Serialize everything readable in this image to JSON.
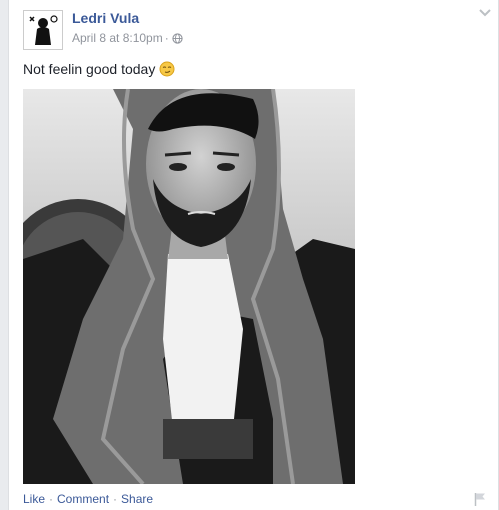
{
  "post": {
    "author": "Ledri Vula",
    "timestamp": "April 8 at 8:10pm",
    "separator": "·",
    "privacy_icon": "globe-icon",
    "status_text": "Not feelin good today",
    "emoji": "smirk-emoji",
    "photo_description_icon": "photo"
  },
  "actions": {
    "like": "Like",
    "comment": "Comment",
    "share": "Share",
    "dot": "·"
  },
  "colors": {
    "link": "#3b5998",
    "meta": "#90949c"
  }
}
